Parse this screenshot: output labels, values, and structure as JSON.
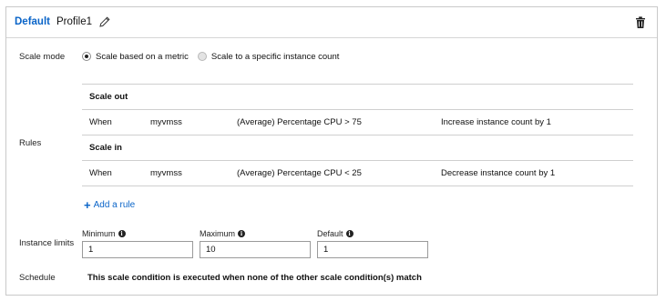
{
  "header": {
    "tag": "Default",
    "profile_name": "Profile1"
  },
  "scale_mode": {
    "label": "Scale mode",
    "options": [
      {
        "label": "Scale based on a metric",
        "selected": true
      },
      {
        "label": "Scale to a specific instance count",
        "selected": false
      }
    ]
  },
  "rules": {
    "label": "Rules",
    "sections": [
      {
        "title": "Scale out",
        "rows": [
          {
            "when": "When",
            "resource": "myvmss",
            "condition": "(Average) Percentage CPU > 75",
            "action": "Increase instance count by 1"
          }
        ]
      },
      {
        "title": "Scale in",
        "rows": [
          {
            "when": "When",
            "resource": "myvmss",
            "condition": "(Average) Percentage CPU < 25",
            "action": "Decrease instance count by 1"
          }
        ]
      }
    ],
    "add_rule_label": "Add a rule"
  },
  "instance_limits": {
    "label": "Instance limits",
    "minimum": {
      "label": "Minimum",
      "value": "1"
    },
    "maximum": {
      "label": "Maximum",
      "value": "10"
    },
    "default": {
      "label": "Default",
      "value": "1"
    }
  },
  "schedule": {
    "label": "Schedule",
    "text": "This scale condition is executed when none of the other scale condition(s) match"
  },
  "colors": {
    "accent": "#0a64c8",
    "border": "#c9c9c9"
  },
  "icons": {
    "edit": "pencil-icon",
    "delete": "trash-icon",
    "info": "info-icon",
    "add": "plus-icon"
  }
}
